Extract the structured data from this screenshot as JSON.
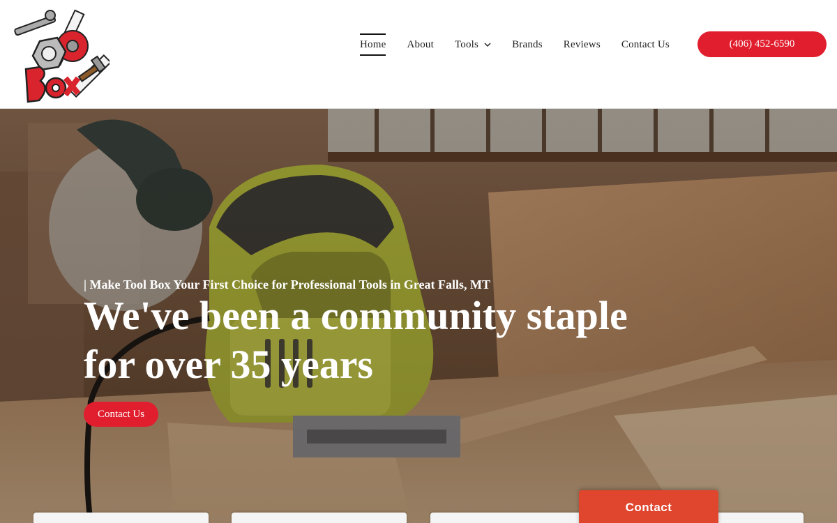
{
  "header": {
    "logo_text": "Tool Box",
    "nav": [
      {
        "label": "Home",
        "active": true
      },
      {
        "label": "About"
      },
      {
        "label": "Tools",
        "has_dropdown": true
      },
      {
        "label": "Brands"
      },
      {
        "label": "Reviews"
      },
      {
        "label": "Contact Us"
      }
    ],
    "phone_label": "(406) 452-6590"
  },
  "hero": {
    "tagline": "| Make Tool Box Your First Choice for Professional Tools in Great Falls, MT",
    "headline": "We've been a community staple for over 35 years",
    "cta_label": "Contact Us"
  },
  "floating_contact_label": "Contact",
  "colors": {
    "accent": "#e01e2e",
    "contact_tab": "#e0462e"
  }
}
